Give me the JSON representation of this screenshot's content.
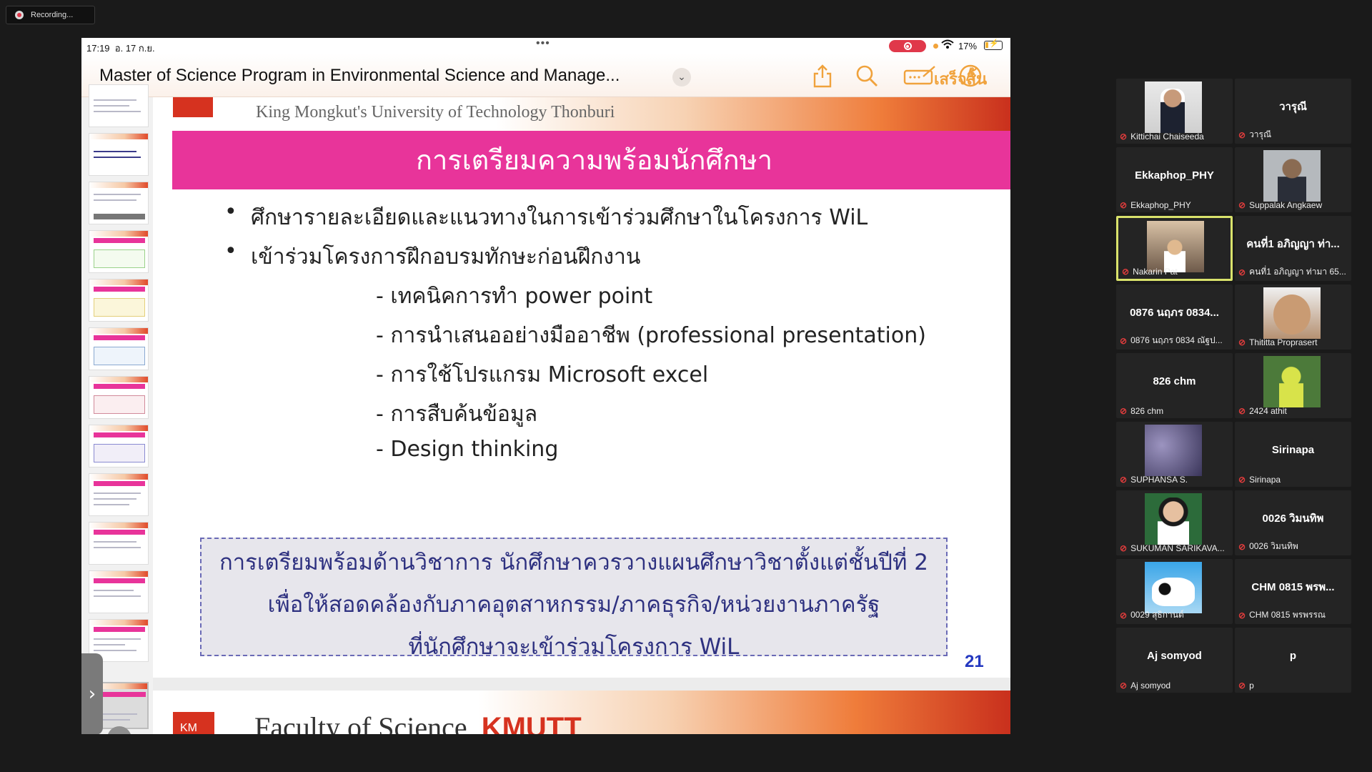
{
  "recording": {
    "label": "Recording..."
  },
  "status_bar": {
    "time": "17:19",
    "date": "อ. 17 ก.ย.",
    "battery": "17%"
  },
  "toolbar": {
    "title": "Master of Science Program in Environmental Science and Manage...",
    "done_label": "เสร็จสิ้น",
    "accent_color": "#f0a23c"
  },
  "slide": {
    "university": "King Mongkut's University of Technology Thonburi",
    "title": "การเตรียมความพร้อมนักศึกษา",
    "bullets": [
      "ศึกษารายละเอียดและแนวทางในการเข้าร่วมศึกษาในโครงการ WiL",
      "เข้าร่วมโครงการฝึกอบรมทักษะก่อนฝึกงาน"
    ],
    "sub_bullets": [
      "- เทคนิคการทำ power point",
      "- การนำเสนออย่างมืออาชีพ (professional presentation)",
      "- การใช้โปรแกรม Microsoft excel",
      "- การสืบค้นข้อมูล",
      "- Design thinking"
    ],
    "callout_lines": [
      "การเตรียมพร้อมด้านวิชาการ นักศึกษาควรวางแผนศึกษาวิชาตั้งแต่ชั้นปีที่ 2",
      "เพื่อให้สอดคล้องกับภาคอุตสาหกรรม/ภาคธุรกิจ/หน่วยงานภาครัฐ",
      "ที่นักศึกษาจะเข้าร่วมโครงการ WiL"
    ],
    "page_number": "21",
    "pink_color": "#e8349a"
  },
  "next_slide": {
    "title_prefix": "Faculty of Science, ",
    "title_suffix": "KMUTT",
    "logo_text": "KM"
  },
  "participants": [
    {
      "label": "Kittichai Chaiseeda",
      "center": "",
      "photo": "ph1"
    },
    {
      "label": "วารุณี",
      "center": "วารุณี",
      "photo": ""
    },
    {
      "label": "Ekkaphop_PHY",
      "center": "Ekkaphop_PHY",
      "photo": ""
    },
    {
      "label": "Suppalak Angkaew",
      "center": "",
      "photo": "ph2"
    },
    {
      "label": "Nakarin Pat",
      "center": "",
      "photo": "ph3"
    },
    {
      "label": "คนที่1 อภิญญา ท่ามา 65...",
      "center": "คนที่1 อภิญญา ท่า...",
      "photo": ""
    },
    {
      "label": "0876 นฤภร 0834 ณัฐป...",
      "center": "0876 นฤภร 0834...",
      "photo": ""
    },
    {
      "label": "Thititta Proprasert",
      "center": "",
      "photo": "ph4"
    },
    {
      "label": "826 chm",
      "center": "826 chm",
      "photo": ""
    },
    {
      "label": "2424 athit",
      "center": "",
      "photo": "ph5"
    },
    {
      "label": "SUPHANSA S.",
      "center": "",
      "photo": "ph6"
    },
    {
      "label": "Sirinapa",
      "center": "Sirinapa",
      "photo": ""
    },
    {
      "label": "SUKUMAN SARIKAVA...",
      "center": "",
      "photo": "ph7"
    },
    {
      "label": "0026 วิมนทิพ",
      "center": "0026 วิมนทิพ",
      "photo": ""
    },
    {
      "label": "0029 สุธิกานต์",
      "center": "",
      "photo": "ph8"
    },
    {
      "label": "CHM 0815 พรพรรณ",
      "center": "CHM 0815 พรพ...",
      "photo": ""
    },
    {
      "label": "Aj somyod",
      "center": "Aj somyod",
      "photo": ""
    },
    {
      "label": "p",
      "center": "p",
      "photo": ""
    }
  ]
}
